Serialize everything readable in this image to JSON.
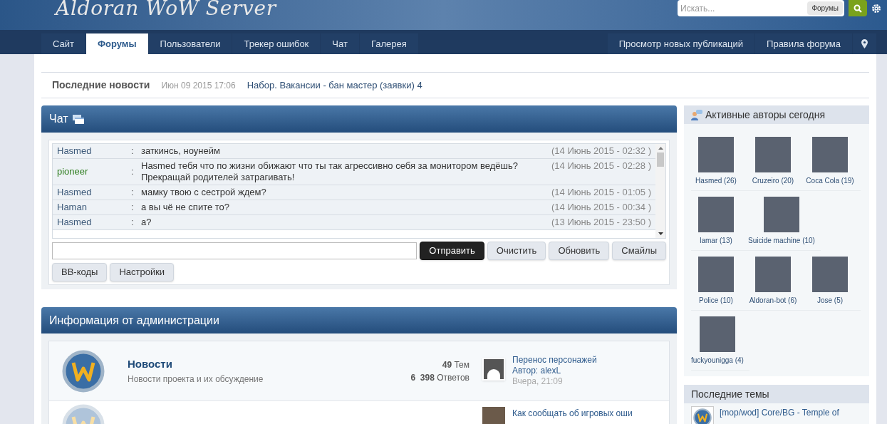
{
  "header": {
    "logo": "Aldoran WoW Server",
    "search": {
      "placeholder": "Искать...",
      "scope": "Форумы"
    }
  },
  "nav": {
    "left": [
      {
        "label": "Сайт",
        "selected": false
      },
      {
        "label": "Форумы",
        "selected": true
      },
      {
        "label": "Пользователи",
        "selected": false
      },
      {
        "label": "Трекер ошибок",
        "selected": false
      },
      {
        "label": "Чат",
        "selected": false
      },
      {
        "label": "Галерея",
        "selected": false
      }
    ],
    "right": [
      "Просмотр новых публикаций",
      "Правила форума"
    ]
  },
  "news_ticker": {
    "label": "Последние новости",
    "date": "Июн 09 2015 17:06",
    "headline": "Набор. Вакансии - бан мастер (заявки) 4"
  },
  "chat": {
    "title": "Чат",
    "messages": [
      {
        "user": "Hasmed",
        "color": "#3d5a7a",
        "separator": ":",
        "text": "заткинсь, ноунейм",
        "time": "(14 Июнь 2015 - 02:32 )"
      },
      {
        "user": "pioneer",
        "color": "#2e7d1e",
        "separator": ":",
        "text": "Hasmed тебя что по жизни обижают что ты так агрессивно себя за монитором ведёшь? Прекращай родителей затрагивать!",
        "time": "(14 Июнь 2015 - 02:28 )"
      },
      {
        "user": "Hasmed",
        "color": "#3d5a7a",
        "separator": ":",
        "text": "мамку твою с сестрой ждем?",
        "time": "(14 Июнь 2015 - 01:05 )"
      },
      {
        "user": "Haman",
        "color": "#3d5a7a",
        "separator": ":",
        "text": "а вы чё не спите то?",
        "time": "(14 Июнь 2015 - 00:34 )"
      },
      {
        "user": "Hasmed",
        "color": "#3d5a7a",
        "separator": ":",
        "text": "а?",
        "time": "(13 Июнь 2015 - 23:50 )"
      }
    ],
    "buttons": [
      {
        "label": "Отправить",
        "kind": "primary"
      },
      {
        "label": "Очистить",
        "kind": "normal"
      },
      {
        "label": "Обновить",
        "kind": "normal"
      },
      {
        "label": "Смайлы",
        "kind": "normal"
      },
      {
        "label": "BB-коды",
        "kind": "normal"
      },
      {
        "label": "Настройки",
        "kind": "normal"
      }
    ]
  },
  "admin_section": {
    "title": "Информация от администрации",
    "forums": [
      {
        "title": "Новости",
        "description": "Новости проекта и их обсуждение",
        "topics": "49",
        "topics_label": "Тем",
        "replies": "6  398",
        "replies_label": "Ответов",
        "last_post": {
          "title": "Перенос персонажей",
          "author": "Автор: alexL",
          "time": "Вчера, 21:09"
        }
      },
      {
        "last_post": {
          "title": "Как сообщать об игровых оши"
        }
      }
    ]
  },
  "active_authors": {
    "title": "Активные авторы сегодня",
    "rows": [
      [
        "Hasmed (26)",
        "Cruzeiro (20)",
        "Coca Cola (19)"
      ],
      [
        "lamar (13)",
        "Suicide machine (10)"
      ],
      [
        "Police (10)",
        "Aldoran-bot (6)",
        "Jose (5)"
      ],
      [
        "fuckyounigga (4)"
      ]
    ]
  },
  "latest_topics": {
    "title": "Последние темы",
    "items": [
      "[mop/wod] Core/BG - Temple of"
    ]
  }
}
